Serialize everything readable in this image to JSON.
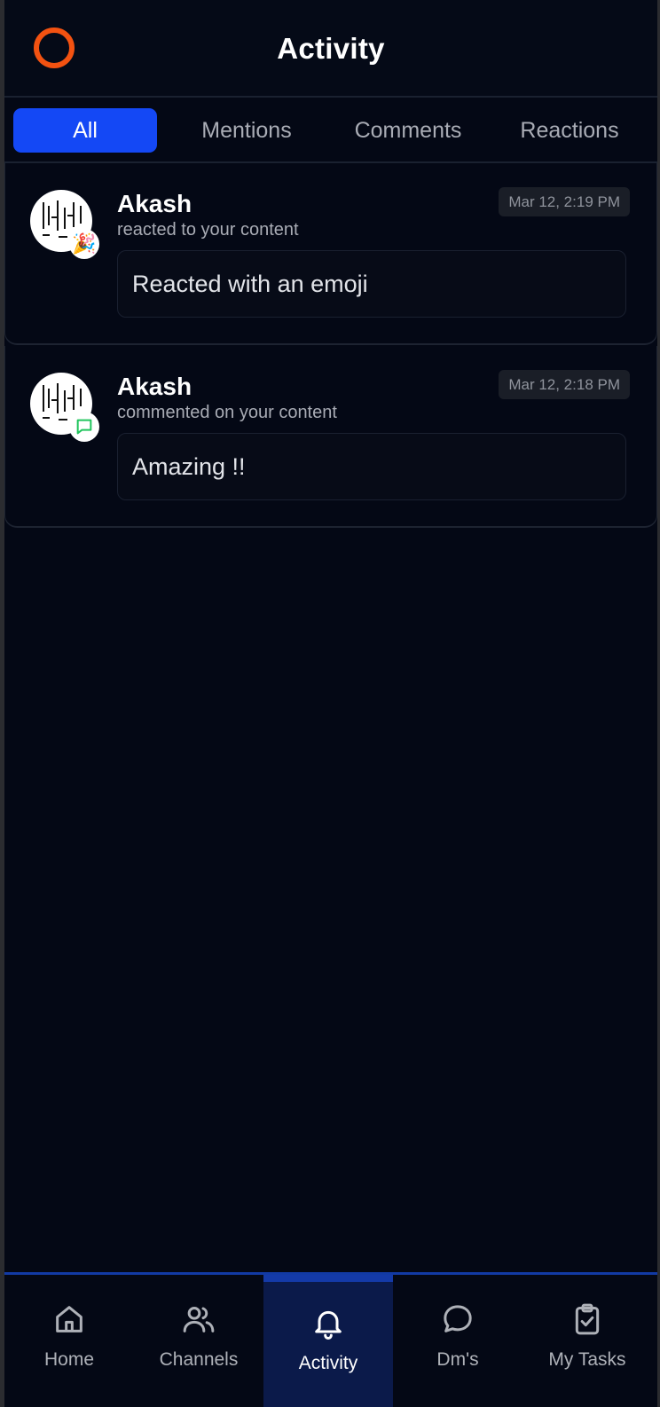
{
  "header": {
    "title": "Activity"
  },
  "tabs": [
    {
      "label": "All",
      "active": true
    },
    {
      "label": "Mentions",
      "active": false
    },
    {
      "label": "Comments",
      "active": false
    },
    {
      "label": "Reactions",
      "active": false
    }
  ],
  "activities": [
    {
      "name": "Akash",
      "action": "reacted to your content",
      "time": "Mar 12, 2:19 PM",
      "message": "Reacted with an emoji",
      "badge_icon": "party-popper-icon",
      "badge_glyph": "🎉"
    },
    {
      "name": "Akash",
      "action": "commented on your content",
      "time": "Mar 12, 2:18 PM",
      "message": "Amazing !!",
      "badge_icon": "comment-icon"
    }
  ],
  "nav": [
    {
      "label": "Home",
      "icon": "home-icon",
      "active": false
    },
    {
      "label": "Channels",
      "icon": "users-icon",
      "active": false
    },
    {
      "label": "Activity",
      "icon": "bell-icon",
      "active": true
    },
    {
      "label": "Dm's",
      "icon": "chat-bubble-icon",
      "active": false
    },
    {
      "label": "My Tasks",
      "icon": "clipboard-check-icon",
      "active": false
    }
  ],
  "colors": {
    "background": "#040815",
    "accent": "#1448f5",
    "logo": "#f35211",
    "comment_badge": "#22c55e"
  }
}
